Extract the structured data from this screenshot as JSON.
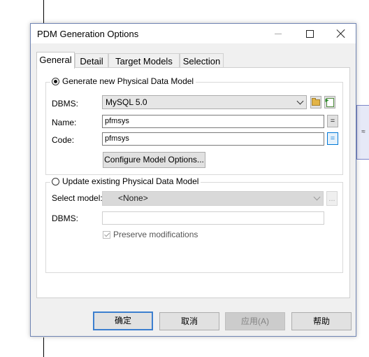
{
  "window": {
    "title": "PDM Generation Options",
    "minimize": "minimize",
    "maximize": "maximize",
    "close": "close"
  },
  "side_panel_glyph": "≈",
  "tabs": [
    {
      "label": "General",
      "active": true
    },
    {
      "label": "Detail",
      "active": false
    },
    {
      "label": "Target Models",
      "active": false
    },
    {
      "label": "Selection",
      "active": false
    }
  ],
  "generate_group": {
    "legend": "Generate new Physical Data Model",
    "selected": true,
    "dbms_label": "DBMS:",
    "dbms_value": "MySQL 5.0",
    "name_label": "Name:",
    "name_value": "pfmsys",
    "name_eq": "=",
    "code_label": "Code:",
    "code_value": "pfmsys",
    "code_eq": "=",
    "configure_button": "Configure Model Options..."
  },
  "update_group": {
    "legend": "Update existing Physical Data Model",
    "selected": false,
    "select_model_label": "Select model:",
    "select_model_value": "<None>",
    "browse_button": "...",
    "dbms_label": "DBMS:",
    "dbms_value": "",
    "preserve_label": "Preserve modifications",
    "preserve_checked": true
  },
  "buttons": {
    "ok": "确定",
    "cancel": "取消",
    "apply": "应用(A)",
    "help": "帮助"
  }
}
